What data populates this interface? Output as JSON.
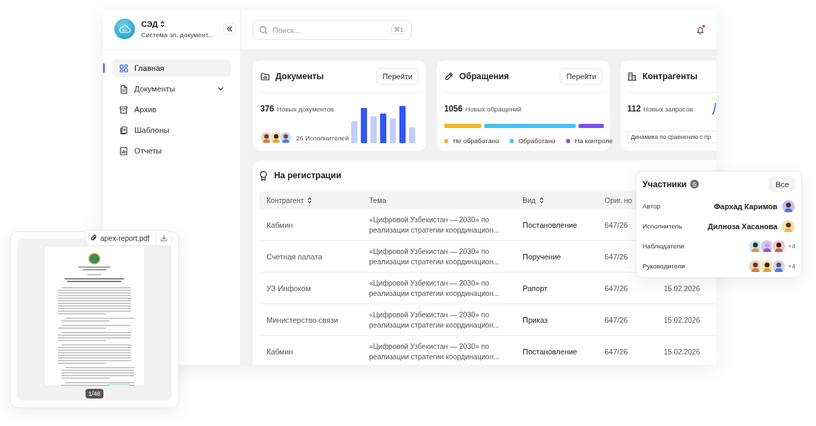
{
  "sidebar": {
    "app_title": "СЭД",
    "app_subtitle": "Система эл. документ...",
    "nav_items": [
      {
        "label": "Главная",
        "selected": true,
        "expandable": false
      },
      {
        "label": "Документы",
        "selected": false,
        "expandable": true
      },
      {
        "label": "Архив",
        "selected": false,
        "expandable": false
      },
      {
        "label": "Шаблоны",
        "selected": false,
        "expandable": false
      },
      {
        "label": "Отчеты",
        "selected": false,
        "expandable": false
      }
    ]
  },
  "header": {
    "search_placeholder": "Поиск...",
    "shortcut": "⌘1",
    "notification_unread": true
  },
  "cards": [
    {
      "kind": "bars",
      "title": "Документы",
      "button": "Перейти",
      "count": "376",
      "count_label": "Новых документов",
      "avatars": [
        {
          "kind": "avatar"
        },
        {
          "kind": "avatar"
        },
        {
          "kind": "avatar"
        }
      ],
      "people": "26 Исполнителей"
    },
    {
      "kind": "segments",
      "title": "Обращения",
      "button": "Перейти",
      "count": "1056",
      "count_label": "Новых обращений",
      "segments": [
        {
          "label": "Не обработано",
          "color": "#f4b223"
        },
        {
          "label": "Обработано",
          "color": "#45c1f7"
        },
        {
          "label": "На контроле",
          "color": "#7b4ef0"
        }
      ]
    },
    {
      "kind": "trend",
      "title": "Контрагенты",
      "count": "112",
      "count_label": "Новых запросов",
      "note": "Динамика по сравнению с пр"
    }
  ],
  "registration": {
    "title": "На регистрации",
    "columns": [
      {
        "label": "Контрагент",
        "sortable": true
      },
      {
        "label": "Тема",
        "sortable": false
      },
      {
        "label": "Вид",
        "sortable": true
      },
      {
        "label": "Ориг. но",
        "sortable": false
      }
    ],
    "rows": [
      {
        "counterparty": "Кабмин",
        "subject": "«Цифровой Узбекистан — 2030» по реализации стратегии координацион...",
        "type": "Постановление",
        "orig_number": "647/26"
      },
      {
        "counterparty": "Счетная палата",
        "subject": "«Цифровой Узбекистан — 2030» по реализации стратегии координацион...",
        "type": "Поручение",
        "orig_number": "647/26"
      },
      {
        "counterparty": "УЗ Инфоком",
        "subject": "«Цифровой Узбекистан — 2030» по реализации стратегии координацион...",
        "type": "Рапорт",
        "orig_number": "647/26",
        "date": "15.02.2026"
      },
      {
        "counterparty": "Министерство связи",
        "subject": "«Цифровой Узбекистан — 2030» по реализации стратегии координацион...",
        "type": "Приказ",
        "orig_number": "647/26",
        "date": "15.02.2026"
      },
      {
        "counterparty": "Кабмин",
        "subject": "«Цифровой Узбекистан — 2030» по реализации стратегии координацион...",
        "type": "Постановление",
        "orig_number": "647/26",
        "date": "15.02.2026"
      }
    ]
  },
  "participants": {
    "title": "Участники",
    "count": "5",
    "button": "Все",
    "rows": [
      {
        "label": "Автор",
        "name": "Фархад Каримов",
        "avatars": [
          {
            "kind": "avatar"
          }
        ]
      },
      {
        "label": "Исполнитель",
        "name": "Дилноза Хасанова",
        "avatars": [
          {
            "kind": "avatar"
          }
        ]
      },
      {
        "label": "Наблюдатели",
        "avatars": [
          {
            "kind": "avatar"
          },
          {
            "kind": "avatar"
          },
          {
            "kind": "avatar"
          }
        ],
        "more": "+4"
      },
      {
        "label": "Руководители",
        "avatars": [
          {
            "kind": "avatar"
          },
          {
            "kind": "avatar"
          },
          {
            "kind": "avatar"
          }
        ],
        "more": "+4"
      }
    ]
  },
  "attachment": {
    "file_name": "apex-report.pdf",
    "page": "1/48"
  }
}
